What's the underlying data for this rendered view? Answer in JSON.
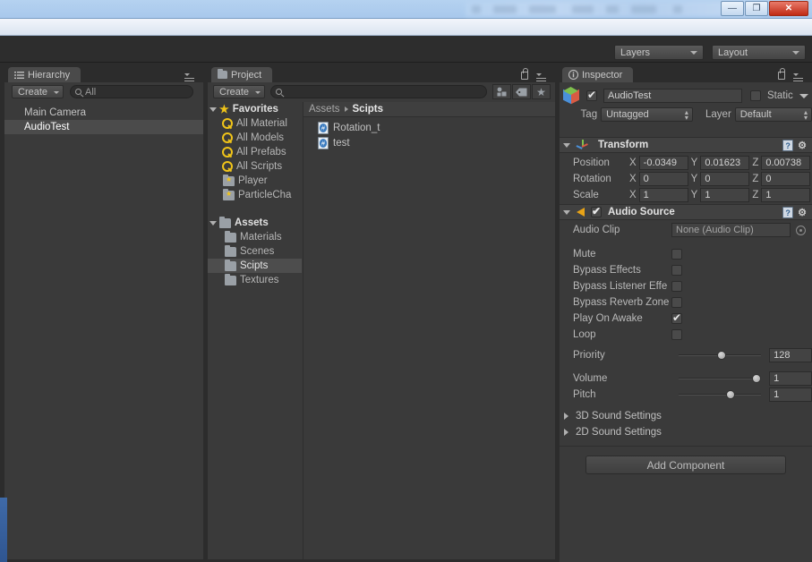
{
  "window": {
    "minimize_label": "—",
    "maximize_label": "❐",
    "close_label": "✕"
  },
  "toolbar": {
    "layers_label": "Layers",
    "layout_label": "Layout"
  },
  "hierarchy": {
    "tab_label": "Hierarchy",
    "create_label": "Create",
    "search_placeholder": "All",
    "search_value": "All",
    "items": [
      {
        "label": "Main Camera",
        "selected": false
      },
      {
        "label": "AudioTest",
        "selected": true
      }
    ]
  },
  "project": {
    "tab_label": "Project",
    "create_label": "Create",
    "search_value": "",
    "favorites": {
      "label": "Favorites",
      "items": [
        {
          "label": "All Material",
          "icon": "search-icon"
        },
        {
          "label": "All Models",
          "icon": "search-icon"
        },
        {
          "label": "All Prefabs",
          "icon": "search-icon"
        },
        {
          "label": "All Scripts",
          "icon": "search-icon"
        },
        {
          "label": "Player",
          "icon": "favorite-folder-icon"
        },
        {
          "label": "ParticleCha",
          "icon": "favorite-folder-icon"
        }
      ]
    },
    "assets": {
      "label": "Assets",
      "items": [
        {
          "label": "Materials",
          "selected": false
        },
        {
          "label": "Scenes",
          "selected": false
        },
        {
          "label": "Scipts",
          "selected": true
        },
        {
          "label": "Textures",
          "selected": false
        }
      ]
    },
    "breadcrumb": {
      "root": "Assets",
      "current": "Scipts"
    },
    "files": [
      {
        "label": "Rotation_t",
        "icon": "csharp-script-icon"
      },
      {
        "label": "test",
        "icon": "csharp-script-icon"
      }
    ]
  },
  "inspector": {
    "tab_label": "Inspector",
    "object": {
      "enabled": true,
      "name": "AudioTest",
      "static_label": "Static",
      "static_checked": false,
      "tag_label": "Tag",
      "tag_value": "Untagged",
      "layer_label": "Layer",
      "layer_value": "Default"
    },
    "transform": {
      "title": "Transform",
      "rows": [
        {
          "label": "Position",
          "x": "-0.0349",
          "y": "0.01623",
          "z": "0.00738"
        },
        {
          "label": "Rotation",
          "x": "0",
          "y": "0",
          "z": "0"
        },
        {
          "label": "Scale",
          "x": "1",
          "y": "1",
          "z": "1"
        }
      ],
      "axis_x": "X",
      "axis_y": "Y",
      "axis_z": "Z"
    },
    "audio_source": {
      "title": "Audio Source",
      "enabled": true,
      "clip_label": "Audio Clip",
      "clip_value": "None (Audio Clip)",
      "toggles": [
        {
          "label": "Mute",
          "checked": false
        },
        {
          "label": "Bypass Effects",
          "checked": false
        },
        {
          "label": "Bypass Listener Effe",
          "checked": false
        },
        {
          "label": "Bypass Reverb Zone",
          "checked": false
        },
        {
          "label": "Play On Awake",
          "checked": true
        },
        {
          "label": "Loop",
          "checked": false
        }
      ],
      "sliders": [
        {
          "label": "Priority",
          "value": "128",
          "pct": 52
        },
        {
          "label": "Volume",
          "value": "1",
          "pct": 96
        },
        {
          "label": "Pitch",
          "value": "1",
          "pct": 64
        }
      ],
      "foldouts": [
        {
          "label": "3D Sound Settings"
        },
        {
          "label": "2D Sound Settings"
        }
      ]
    },
    "add_component_label": "Add Component"
  }
}
